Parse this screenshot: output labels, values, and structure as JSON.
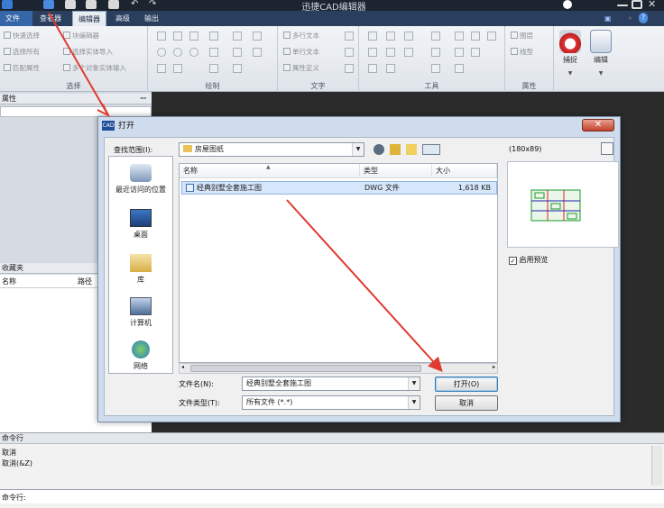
{
  "app": {
    "title": "迅捷CAD编辑器"
  },
  "menubar": {
    "items": [
      "文件",
      "查看器",
      "编辑器",
      "高级",
      "输出"
    ],
    "active": "编辑器"
  },
  "ribbon": {
    "select_group": {
      "label": "选择",
      "items": [
        "快速选择",
        "选择所有",
        "匹配属性"
      ],
      "items2": [
        "块编辑器",
        "选择实体导入",
        "多个对象实体输入"
      ]
    },
    "draw_group": {
      "label": "绘制"
    },
    "text_group": {
      "label": "文字",
      "items": [
        "多行文本",
        "单行文本",
        "属性定义"
      ]
    },
    "tools_group": {
      "label": "工具"
    },
    "props_group": {
      "label": "属性",
      "items": [
        "图层",
        "线型"
      ]
    },
    "snap_button": "捕捉",
    "edit_button": "编辑"
  },
  "left_panel": {
    "properties_header": "属性",
    "favorites_header": "收藏夹",
    "columns": [
      "名称",
      "路径"
    ]
  },
  "command": {
    "header": "命令行",
    "lines": [
      "取消",
      "取消(&Z)"
    ],
    "prompt": "命令行:"
  },
  "dialog": {
    "title": "打开",
    "close_glyph": "✕",
    "look_in_label": "查找范围(I):",
    "look_in_value": "房屋图纸",
    "places": [
      "最近访问的位置",
      "桌面",
      "库",
      "计算机",
      "网络"
    ],
    "columns": [
      "名称",
      "类型",
      "大小"
    ],
    "file": {
      "name": "经典别墅全套施工图",
      "type": "DWG 文件",
      "size": "1,618 KB"
    },
    "filename_label": "文件名(N):",
    "filename_value": "经典别墅全套施工图",
    "filetype_label": "文件类型(T):",
    "filetype_value": "所有文件 (*.*)",
    "open_button": "打开(O)",
    "cancel_button": "取消",
    "preview_size": "(180x89)",
    "preview_checkbox": "启用预览",
    "preview_enabled": true
  },
  "colors": {
    "accent": "#3566a8",
    "arrow": "#e03a2f"
  }
}
